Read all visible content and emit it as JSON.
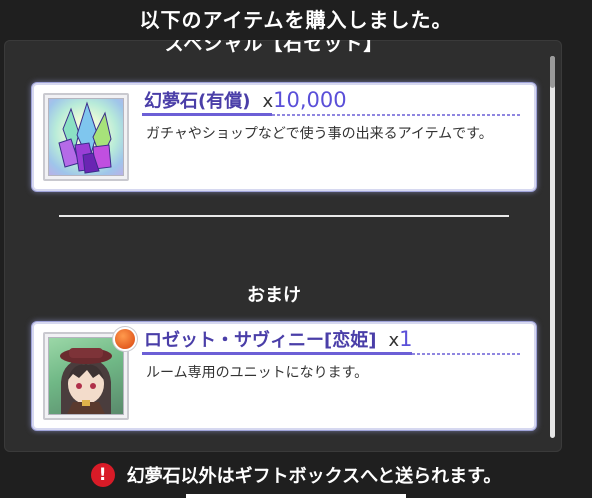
{
  "title": "以下のアイテムを購入しました。",
  "cut_header": "スペシャル【石セット】",
  "purchased_item": {
    "name": "幻夢石(有償)",
    "quantity_prefix": "x",
    "quantity": "10,000",
    "description": "ガチャやショップなどで使う事の出来るアイテムです。",
    "icon": "crystal-icon"
  },
  "bonus_heading": "おまけ",
  "bonus_item": {
    "name": "ロゼット・サヴィニー[恋姫]",
    "quantity_prefix": "x",
    "quantity": "1",
    "description": "ルーム専用のユニットになります。",
    "icon": "character-portrait",
    "badge_icon": "fire-element-icon"
  },
  "notice": {
    "icon": "warning-icon",
    "icon_glyph": "!",
    "text": "幻夢石以外はギフトボックスへと送られます。"
  },
  "colors": {
    "accent": "#5a4fd8",
    "warning": "#d81b27",
    "panel": "#2e2e2e"
  }
}
